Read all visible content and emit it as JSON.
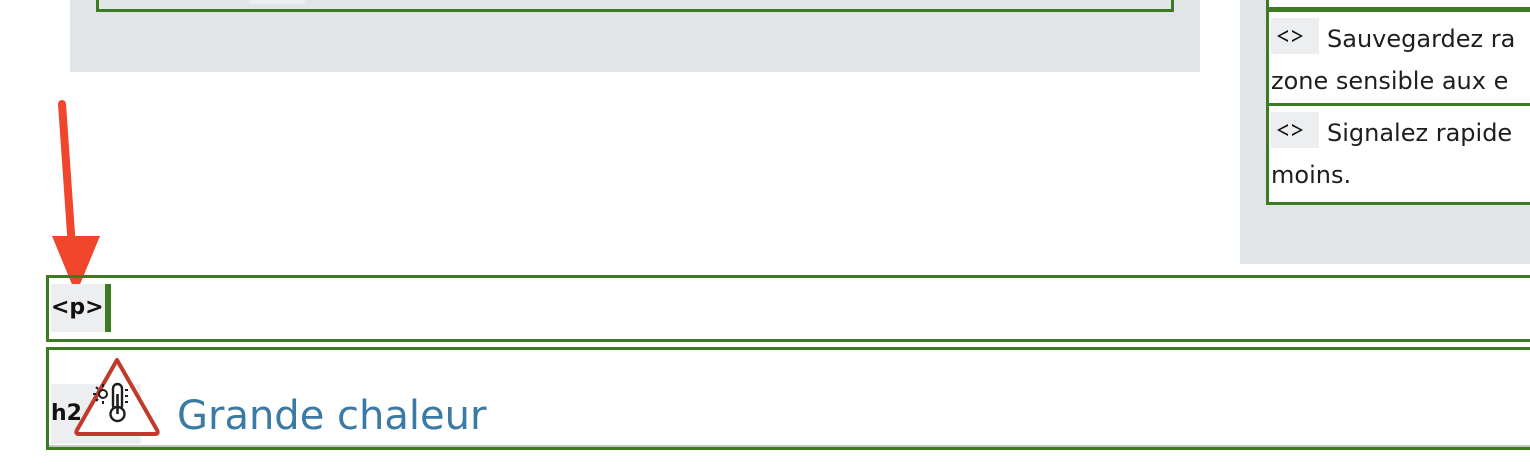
{
  "left_section": {
    "tag_label": ""
  },
  "right_list": {
    "items": [
      {
        "tag": "<>",
        "text": "Sauvegardez ra zone sensible aux e"
      },
      {
        "tag": "<>",
        "text": "Signalez rapide moins."
      }
    ]
  },
  "p_block": {
    "tag": "<p>"
  },
  "heading_block": {
    "tag": "h2",
    "title": "Grande chaleur",
    "icon": "heat-warning-icon"
  },
  "colors": {
    "outline_green": "#3d7b22",
    "panel_grey": "#e2e5e8",
    "heading_blue": "#3b7aa5",
    "arrow_red": "#f0462c",
    "icon_red": "#c0392b"
  }
}
